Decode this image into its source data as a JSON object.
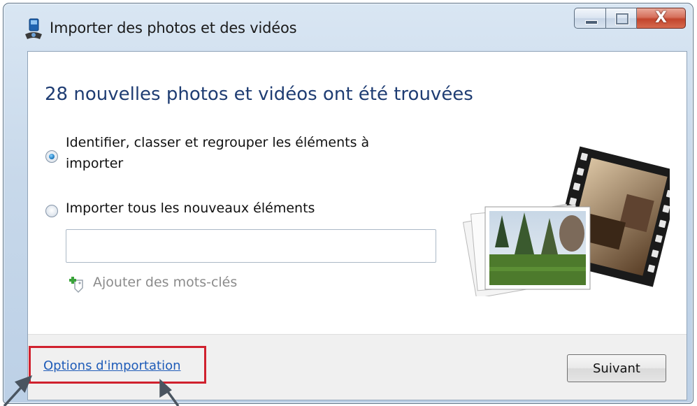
{
  "window": {
    "title": "Importer des photos et des vidéos",
    "close_glyph": "X"
  },
  "main": {
    "heading": "28 nouvelles photos et vidéos ont été trouvées",
    "options": [
      {
        "label": "Identifier, classer et regrouper les éléments à importer",
        "selected": true
      },
      {
        "label": "Importer tous les nouveaux éléments",
        "selected": false
      }
    ],
    "keywords_input": {
      "value": "",
      "placeholder": ""
    },
    "add_keywords_label": "Ajouter des mots-clés"
  },
  "footer": {
    "options_link": "Options d'importation",
    "next_button": "Suivant"
  },
  "colors": {
    "heading": "#1f3d73",
    "link": "#1f5cb8",
    "highlight": "#d0212e",
    "close_button": "#c2452d"
  }
}
